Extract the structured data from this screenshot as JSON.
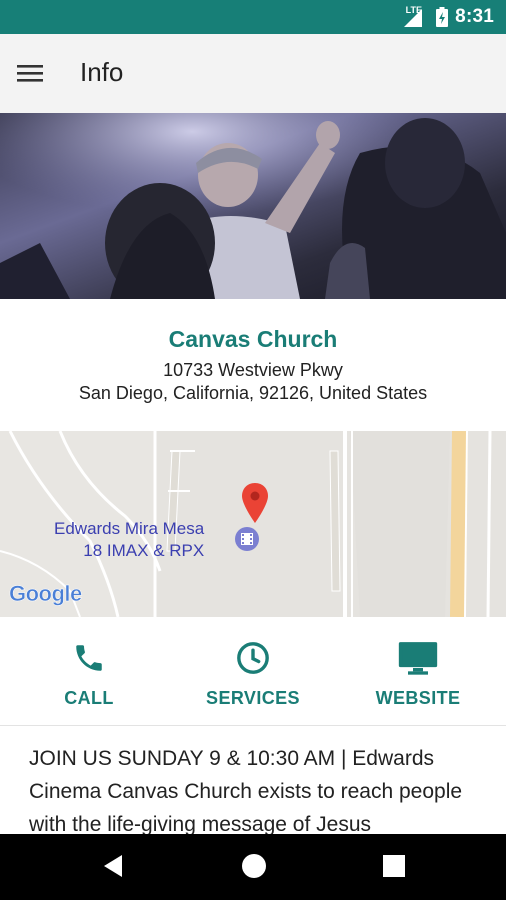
{
  "status_bar": {
    "time": "8:31",
    "network": "LTE"
  },
  "app_bar": {
    "title": "Info",
    "menu_icon": "hamburger-menu-icon"
  },
  "church": {
    "name": "Canvas Church",
    "address_line1": "10733 Westview Pkwy",
    "address_line2": "San Diego, California, 92126, United States"
  },
  "map": {
    "place_label_line1": "Edwards Mira Mesa",
    "place_label_line2": "18 IMAX & RPX",
    "logo": "Google"
  },
  "actions": {
    "call": {
      "label": "CALL",
      "icon": "phone-icon"
    },
    "services": {
      "label": "SERVICES",
      "icon": "clock-icon"
    },
    "website": {
      "label": "WEBSITE",
      "icon": "monitor-icon"
    }
  },
  "description": "JOIN US SUNDAY 9 & 10:30 AM | Edwards Cinema Canvas Church exists to reach people with the life-giving message of Jesus",
  "colors": {
    "accent": "#1a7d76",
    "status_bar": "#177f77"
  }
}
